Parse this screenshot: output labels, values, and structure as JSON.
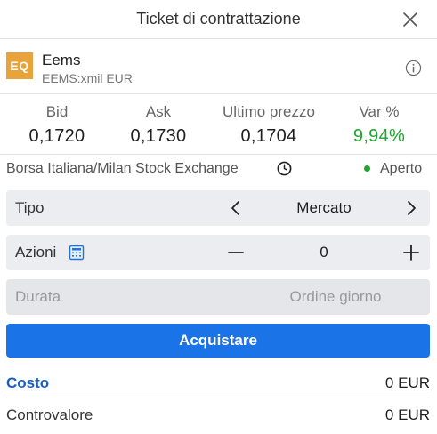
{
  "header": {
    "title": "Ticket di contrattazione"
  },
  "instrument": {
    "badge": "EQ",
    "name": "Eems",
    "symbol": "EEMS:xmil EUR"
  },
  "quotes": {
    "bid": {
      "label": "Bid",
      "value": "0,1720"
    },
    "ask": {
      "label": "Ask",
      "value": "0,1730"
    },
    "last": {
      "label": "Ultimo prezzo",
      "value": "0,1704"
    },
    "change": {
      "label": "Var %",
      "value": "9,94%"
    }
  },
  "market": {
    "exchange": "Borsa Italiana/Milan Stock Exchange",
    "status": "Aperto"
  },
  "order": {
    "type_label": "Tipo",
    "type_value": "Mercato",
    "shares_label": "Azioni",
    "shares_value": "0",
    "duration_label": "Durata",
    "duration_value": "Ordine giorno"
  },
  "buy_button": "Acquistare",
  "summary": {
    "cost_label": "Costo",
    "cost_value": "0 EUR",
    "total_label": "Controvalore",
    "total_value": "0 EUR"
  },
  "colors": {
    "accent": "#1b73e8",
    "badge": "#e8a33b",
    "positive": "#1fa530"
  }
}
